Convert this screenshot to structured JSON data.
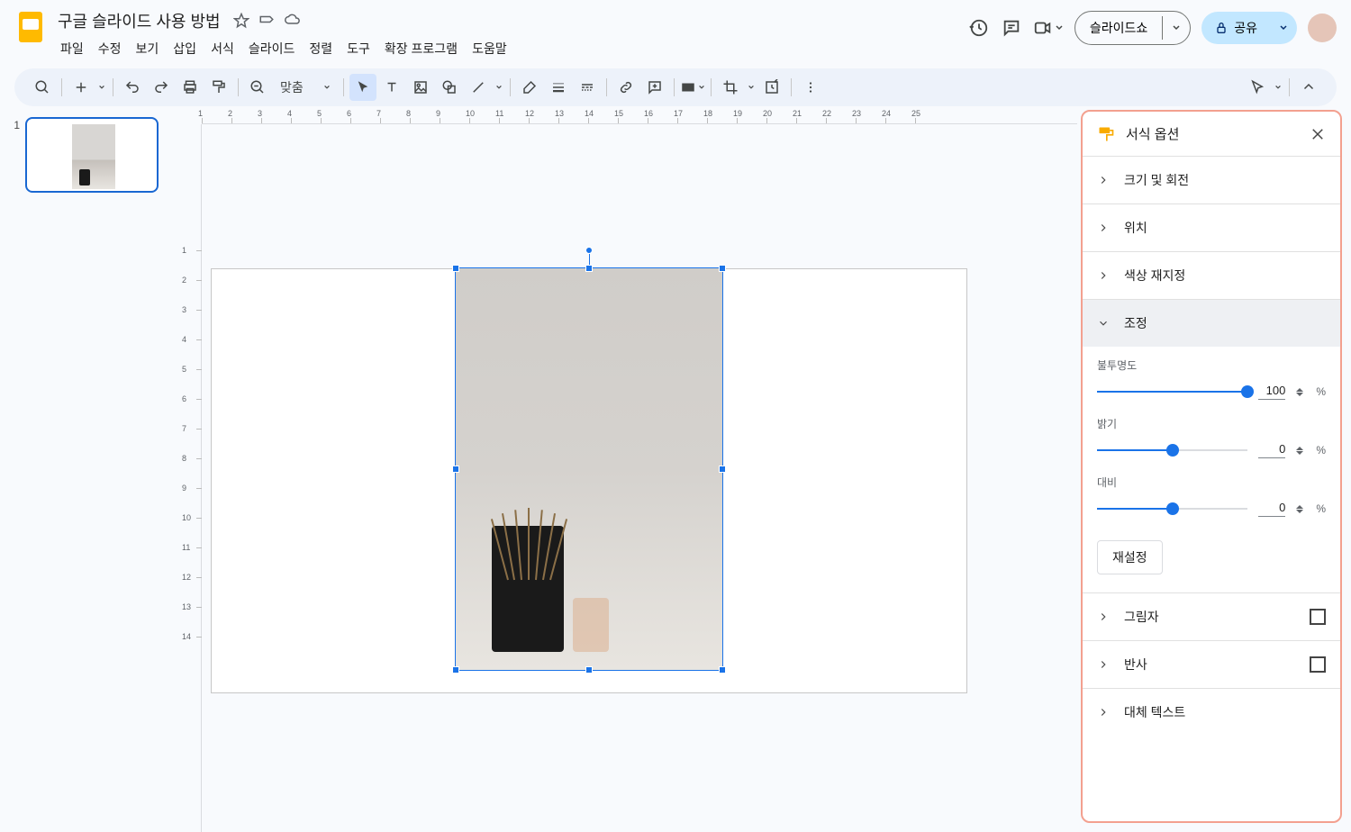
{
  "doc": {
    "title": "구글 슬라이드 사용 방법"
  },
  "menus": [
    "파일",
    "수정",
    "보기",
    "삽입",
    "서식",
    "슬라이드",
    "정렬",
    "도구",
    "확장 프로그램",
    "도움말"
  ],
  "header": {
    "slideshow": "슬라이드쇼",
    "share": "공유"
  },
  "toolbar": {
    "zoom_label": "맞춤"
  },
  "filmstrip": {
    "slides": [
      {
        "num": "1"
      }
    ]
  },
  "ruler_h": [
    "1",
    "2",
    "3",
    "4",
    "5",
    "6",
    "7",
    "8",
    "9",
    "10",
    "11",
    "12",
    "13",
    "14",
    "15",
    "16",
    "17",
    "18",
    "19",
    "20",
    "21",
    "22",
    "23",
    "24",
    "25"
  ],
  "ruler_v": [
    "1",
    "2",
    "3",
    "4",
    "5",
    "6",
    "7",
    "8",
    "9",
    "10",
    "11",
    "12",
    "13",
    "14"
  ],
  "panel": {
    "title": "서식 옵션",
    "sections": {
      "size_rotation": "크기 및 회전",
      "position": "위치",
      "recolor": "색상 재지정",
      "adjust": "조정",
      "shadow": "그림자",
      "reflection": "반사",
      "alt_text": "대체 텍스트"
    },
    "adjust": {
      "opacity": {
        "label": "불투명도",
        "value": "100",
        "unit": "%",
        "fill_pct": 100
      },
      "brightness": {
        "label": "밝기",
        "value": "0",
        "unit": "%",
        "fill_pct": 50
      },
      "contrast": {
        "label": "대비",
        "value": "0",
        "unit": "%",
        "fill_pct": 50
      },
      "reset": "재설정"
    }
  }
}
